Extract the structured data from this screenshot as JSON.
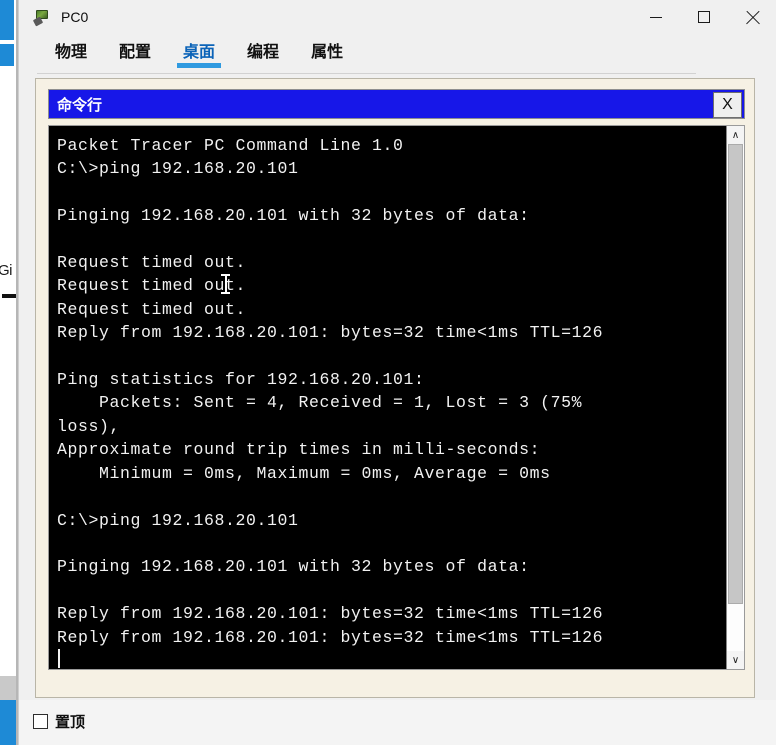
{
  "window": {
    "title": "PC0",
    "icon": "monitor-icon",
    "controls": {
      "minimize": "—",
      "maximize": "□",
      "close": "✕"
    }
  },
  "tabs": [
    {
      "label": "物理",
      "active": false
    },
    {
      "label": "配置",
      "active": false
    },
    {
      "label": "桌面",
      "active": true
    },
    {
      "label": "编程",
      "active": false
    },
    {
      "label": "属性",
      "active": false
    }
  ],
  "inner_window": {
    "title": "命令行",
    "close_label": "X"
  },
  "terminal": {
    "text": "Packet Tracer PC Command Line 1.0\nC:\\>ping 192.168.20.101\n\nPinging 192.168.20.101 with 32 bytes of data:\n\nRequest timed out.\nRequest timed out.\nRequest timed out.\nReply from 192.168.20.101: bytes=32 time<1ms TTL=126\n\nPing statistics for 192.168.20.101:\n    Packets: Sent = 4, Received = 1, Lost = 3 (75%\nloss),\nApproximate round trip times in milli-seconds:\n    Minimum = 0ms, Maximum = 0ms, Average = 0ms\n\nC:\\>ping 192.168.20.101\n\nPinging 192.168.20.101 with 32 bytes of data:\n\nReply from 192.168.20.101: bytes=32 time<1ms TTL=126\nReply from 192.168.20.101: bytes=32 time<1ms TTL=126",
    "lines": [
      "Packet Tracer PC Command Line 1.0",
      "C:\\>ping 192.168.20.101",
      "",
      "Pinging 192.168.20.101 with 32 bytes of data:",
      "",
      "Request timed out.",
      "Request timed out.",
      "Request timed out.",
      "Reply from 192.168.20.101: bytes=32 time<1ms TTL=126",
      "",
      "Ping statistics for 192.168.20.101:",
      "    Packets: Sent = 4, Received = 1, Lost = 3 (75%",
      "loss),",
      "Approximate round trip times in milli-seconds:",
      "    Minimum = 0ms, Maximum = 0ms, Average = 0ms",
      "",
      "C:\\>ping 192.168.20.101",
      "",
      "Pinging 192.168.20.101 with 32 bytes of data:",
      "",
      "Reply from 192.168.20.101: bytes=32 time<1ms TTL=126",
      "Reply from 192.168.20.101: bytes=32 time<1ms TTL=126"
    ],
    "background_color": "#000000",
    "text_color": "#f2f2f2",
    "ping_target": "192.168.20.101"
  },
  "scrollbar": {
    "up_arrow": "∧",
    "down_arrow": "∨"
  },
  "bottom": {
    "checkbox_label": "置顶",
    "checked": false
  },
  "background": {
    "partial_label": "Gi"
  },
  "colors": {
    "inner_title_blue": "#1717e8",
    "tab_accent": "#2f9ae0",
    "tab_active_text": "#0b63b8",
    "panel_bg": "#f6f1e4",
    "window_bg": "#f0f0f0"
  }
}
